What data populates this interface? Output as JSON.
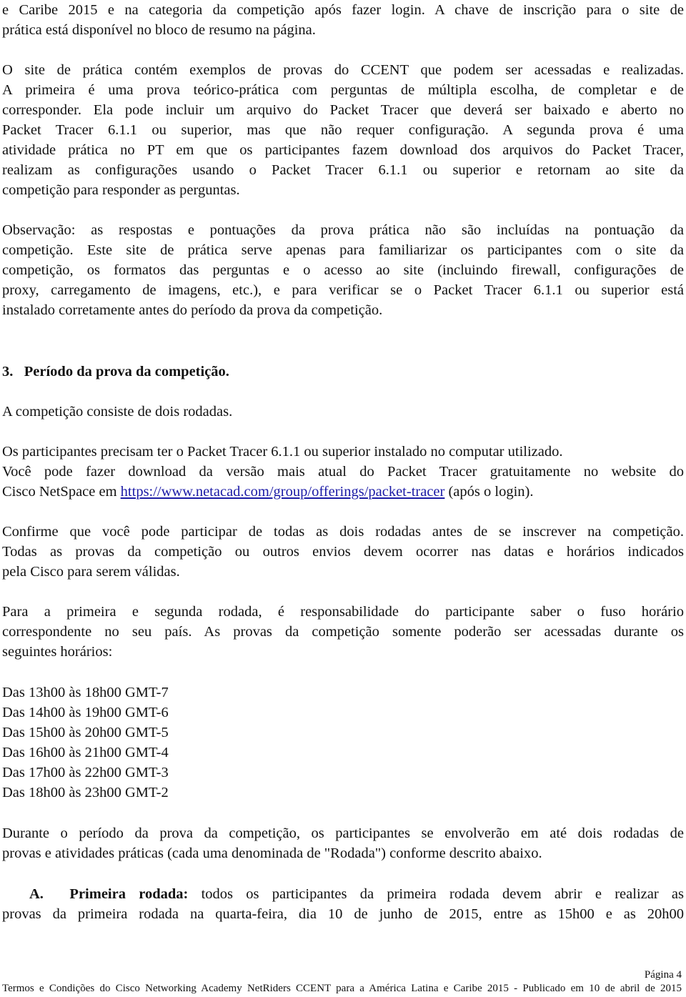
{
  "paragraph_intro": [
    "e Caribe 2015 e na categoria da competição após fazer login. A chave de inscrição para o site de",
    "prática está disponível no bloco de resumo na página."
  ],
  "paragraph_practice_site": [
    "O site de prática contém exemplos de provas do CCENT que podem ser acessadas e realizadas.",
    "A primeira é uma prova teórico-prática com perguntas de múltipla escolha, de completar e de",
    "corresponder. Ela pode incluir um arquivo do Packet Tracer que deverá ser baixado e aberto no",
    "Packet Tracer 6.1.1 ou superior, mas que não requer configuração. A segunda prova é uma",
    "atividade prática no PT em que os participantes fazem download dos arquivos do Packet Tracer,",
    "realizam as configurações usando o Packet Tracer 6.1.1 ou superior e retornam ao site da",
    "competição para responder as perguntas."
  ],
  "paragraph_note": [
    "Observação: as respostas e pontuações da prova prática não são incluídas na pontuação da",
    "competição. Este site de prática serve apenas para familiarizar os participantes com o site da",
    "competição, os formatos das perguntas e o acesso ao site (incluindo firewall, configurações de",
    "proxy, carregamento de imagens, etc.), e para verificar se o Packet Tracer 6.1.1 ou superior está",
    "instalado corretamente antes do período da prova da competição."
  ],
  "section_heading": "3.   Período da prova da competição.",
  "paragraph_rounds": "A competição consiste de dois rodadas.",
  "paragraph_requirements": {
    "line1": "Os participantes precisam ter o Packet Tracer 6.1.1 ou superior instalado no computar utilizado.",
    "line2": "Você pode fazer download da versão mais atual do Packet Tracer gratuitamente no website do",
    "line3_prefix": "Cisco NetSpace em ",
    "link_text": "https://www.netacad.com/group/offerings/packet-tracer",
    "line3_suffix": " (após o login)."
  },
  "paragraph_confirm": [
    "Confirme que você pode participar de todas as dois rodadas antes de se inscrever na competição.",
    "Todas as provas da competição ou outros envios devem ocorrer nas datas e horários indicados",
    "pela Cisco para serem válidas."
  ],
  "paragraph_timezone": [
    "Para a primeira e segunda rodada, é responsabilidade do participante saber o fuso horário",
    "correspondente no seu país. As provas da competição somente poderão ser acessadas durante os",
    "seguintes horários:"
  ],
  "schedule": [
    "Das 13h00 às 18h00 GMT-7",
    "Das 14h00 às 19h00 GMT-6",
    "Das 15h00 às 20h00 GMT-5",
    "Das 16h00 às 21h00 GMT-4",
    "Das 17h00 às 22h00 GMT-3",
    "Das 18h00 às 23h00 GMT-2"
  ],
  "paragraph_period": [
    "Durante o período da prova da competição, os participantes se envolverão em até dois rodadas de",
    "provas e atividades práticas (cada uma denominada de \"Rodada\") conforme descrito abaixo."
  ],
  "first_round": {
    "label": "A.  Primeira rodada:",
    "line1_rest": " todos os participantes da primeira rodada devem abrir e realizar as",
    "line2": "provas da primeira rodada na quarta-feira, dia 10 de junho de 2015, entre as 15h00 e as 20h00"
  },
  "footer": {
    "page": "Página 4",
    "text": "Termos e Condições do Cisco Networking Academy NetRiders CCENT para a América Latina e Caribe 2015 - Publicado em 10 de abril de 2015"
  },
  "colors": {
    "link": "#1a1aa6",
    "text": "#111111"
  }
}
